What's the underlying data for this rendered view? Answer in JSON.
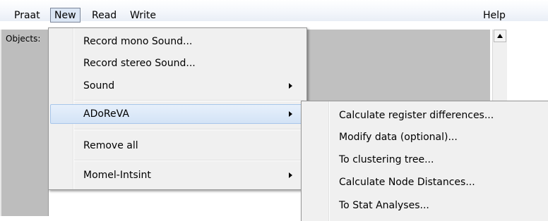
{
  "menubar": {
    "items": [
      "Praat",
      "New",
      "Read",
      "Write"
    ],
    "help": "Help"
  },
  "objects_panel": {
    "label": "Objects:"
  },
  "new_menu": {
    "items": [
      {
        "label": "Record mono Sound..."
      },
      {
        "label": "Record stereo Sound..."
      },
      {
        "label": "Sound"
      },
      {
        "label": "ADoReVA"
      },
      {
        "label": "Remove all"
      },
      {
        "label": "Momel-Intsint"
      }
    ]
  },
  "adoreva_submenu": {
    "items": [
      {
        "label": "Calculate register differences..."
      },
      {
        "label": "Modify data (optional)..."
      },
      {
        "label": "To clustering tree..."
      },
      {
        "label": "Calculate Node Distances..."
      },
      {
        "label": "To Stat Analyses..."
      }
    ]
  },
  "icons": {
    "scroll_up": "scroll-up-arrow-icon",
    "submenu": "submenu-arrow-icon"
  }
}
